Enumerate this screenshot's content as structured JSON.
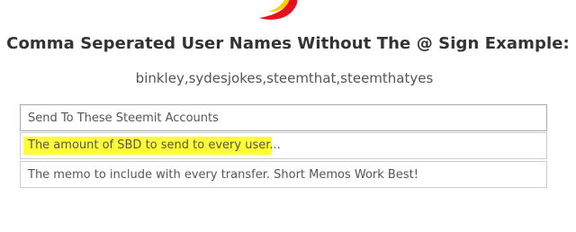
{
  "header": {
    "title": "Comma Seperated User Names Without The @ Sign Example:",
    "example": "binkley,sydesjokes,steemthat,steemthatyes",
    "logo_icon": "steem-logo-icon"
  },
  "form": {
    "accounts": {
      "placeholder": "Send To These Steemit Accounts",
      "value": ""
    },
    "amount": {
      "placeholder": "The amount of SBD to send to every user...",
      "value": "",
      "highlight_color": "#ffff33"
    },
    "memo": {
      "placeholder": "The memo to include with every transfer. Short Memos Work Best!",
      "value": ""
    }
  },
  "colors": {
    "logo_red": "#e8101e",
    "logo_yellow": "#ffd000"
  }
}
